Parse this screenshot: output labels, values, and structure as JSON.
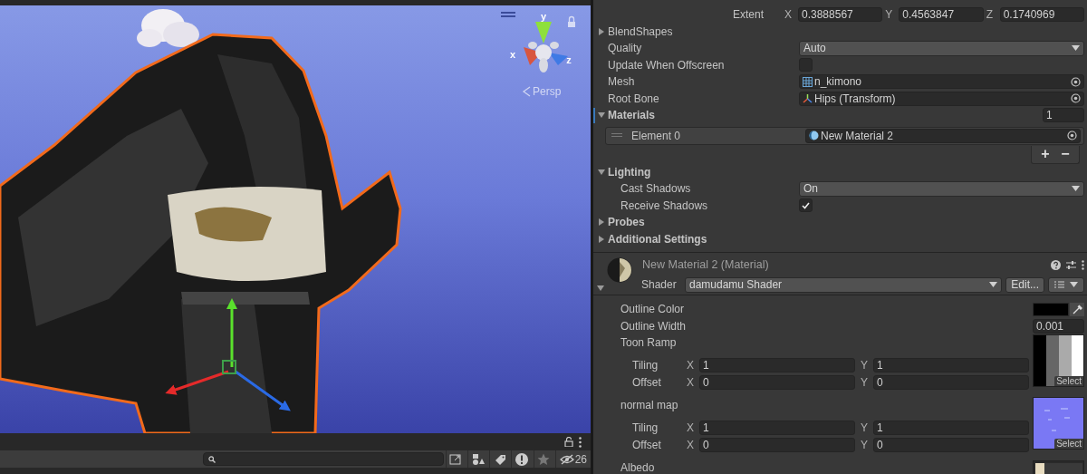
{
  "scene_view": {
    "axis_labels": [
      "y",
      "x",
      "z"
    ],
    "projection_label": "Persp"
  },
  "project_toolbar": {
    "hidden_count": "26"
  },
  "inspector": {
    "rows": [
      {
        "kind": "vector",
        "label": "Extent",
        "fields": [
          {
            "axis": "X",
            "value": "0.3888567"
          },
          {
            "axis": "Y",
            "value": "0.4563847"
          },
          {
            "axis": "Z",
            "value": "0.1740969"
          }
        ]
      },
      {
        "kind": "foldout",
        "label": "BlendShapes",
        "expanded": false
      },
      {
        "kind": "dropdown",
        "label": "Quality",
        "value": "Auto"
      },
      {
        "kind": "checkbox",
        "label": "Update When Offscreen",
        "checked": false
      },
      {
        "kind": "object",
        "label": "Mesh",
        "value": "n_kimono"
      },
      {
        "kind": "object",
        "label": "Root Bone",
        "value": "Hips (Transform)"
      },
      {
        "kind": "section",
        "label": "Materials",
        "expanded": true,
        "count": "1",
        "children": [
          {
            "kind": "element",
            "label": "Element 0",
            "value": "New Material 2"
          },
          {
            "kind": "list_buttons",
            "add": "+",
            "remove": "−"
          }
        ]
      },
      {
        "kind": "section",
        "label": "Lighting",
        "expanded": true,
        "children": [
          {
            "kind": "dropdown",
            "label": "Cast Shadows",
            "value": "On"
          },
          {
            "kind": "checkbox",
            "label": "Receive Shadows",
            "checked": true
          }
        ]
      },
      {
        "kind": "section",
        "label": "Probes",
        "expanded": false
      },
      {
        "kind": "section",
        "label": "Additional Settings",
        "expanded": false
      }
    ]
  },
  "material": {
    "title": "New Material 2 (Material)",
    "expanded": true,
    "shader_label": "Shader",
    "shader": "damudamu Shader",
    "edit_button": "Edit...",
    "properties": [
      {
        "kind": "color",
        "label": "Outline Color",
        "color": "#000000"
      },
      {
        "kind": "float",
        "label": "Outline Width",
        "value": "0.001"
      },
      {
        "kind": "texture",
        "label": "Toon Ramp",
        "select": "Select",
        "rows": [
          {
            "label": "Tiling",
            "fields": [
              {
                "axis": "X",
                "value": "1"
              },
              {
                "axis": "Y",
                "value": "1"
              }
            ]
          },
          {
            "label": "Offset",
            "fields": [
              {
                "axis": "X",
                "value": "0"
              },
              {
                "axis": "Y",
                "value": "0"
              }
            ]
          }
        ]
      },
      {
        "kind": "texture",
        "label": "normal map",
        "select": "Select",
        "rows": [
          {
            "label": "Tiling",
            "fields": [
              {
                "axis": "X",
                "value": "1"
              },
              {
                "axis": "Y",
                "value": "1"
              }
            ]
          },
          {
            "label": "Offset",
            "fields": [
              {
                "axis": "X",
                "value": "0"
              },
              {
                "axis": "Y",
                "value": "0"
              }
            ]
          }
        ]
      },
      {
        "kind": "texture",
        "label": "Albedo"
      }
    ]
  }
}
